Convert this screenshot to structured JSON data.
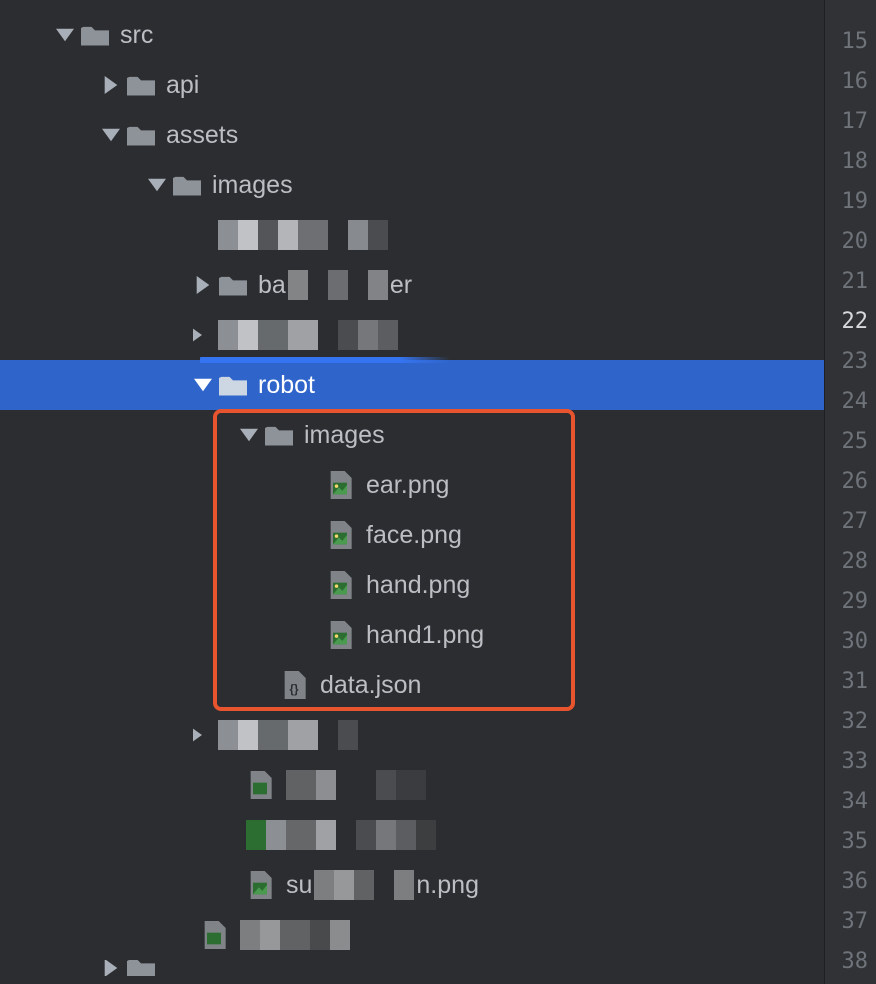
{
  "tree": {
    "src": {
      "label": "src"
    },
    "api": {
      "label": "api"
    },
    "assets": {
      "label": "assets"
    },
    "images": {
      "label": "images"
    },
    "banner_partial": {
      "prefix": "ba",
      "suffix": "er"
    },
    "robot": {
      "label": "robot"
    },
    "robot_images": {
      "label": "images"
    },
    "ear": {
      "label": "ear.png"
    },
    "face": {
      "label": "face.png"
    },
    "hand": {
      "label": "hand.png"
    },
    "hand1": {
      "label": "hand1.png"
    },
    "data_json": {
      "label": "data.json"
    },
    "su_png": {
      "prefix": "su",
      "suffix": "n.png"
    }
  },
  "gutter": {
    "start": 15,
    "end": 38,
    "active": 22
  }
}
